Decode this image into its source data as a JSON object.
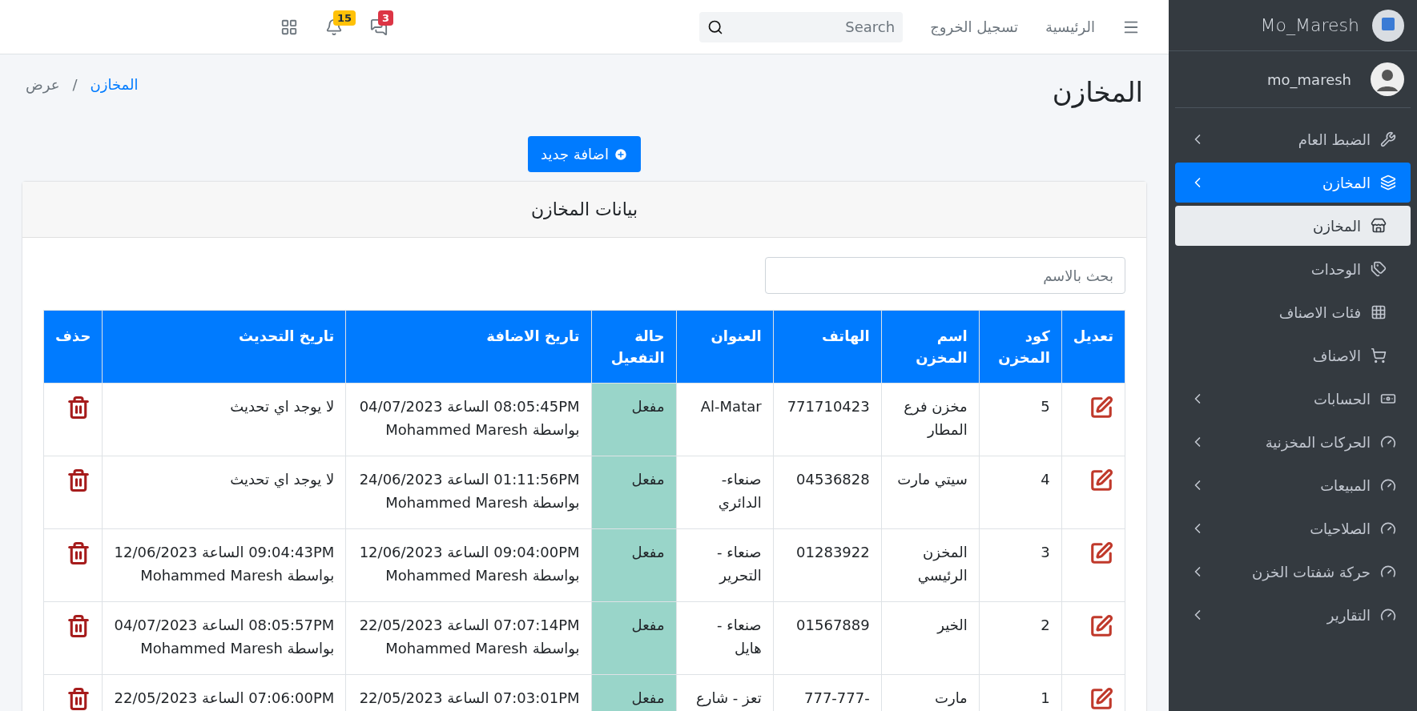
{
  "sidebar": {
    "brand": "Mo_Maresh",
    "user": "mo_maresh",
    "items": [
      {
        "label": "الضبط العام",
        "selected": false,
        "expanded": false,
        "has_arrow": true
      },
      {
        "label": "المخازن",
        "selected": true,
        "expanded": true,
        "has_arrow": true,
        "children": [
          {
            "label": "المخازن",
            "selected": true
          },
          {
            "label": "الوحدات",
            "selected": false
          },
          {
            "label": "فئات الاصناف",
            "selected": false
          },
          {
            "label": "الاصناف",
            "selected": false
          }
        ]
      },
      {
        "label": "الحسابات",
        "selected": false,
        "expanded": false,
        "has_arrow": true
      },
      {
        "label": "الحركات المخزنية",
        "selected": false,
        "expanded": false,
        "has_arrow": true
      },
      {
        "label": "المبيعات",
        "selected": false,
        "expanded": false,
        "has_arrow": true
      },
      {
        "label": "الصلاحيات",
        "selected": false,
        "expanded": false,
        "has_arrow": true
      },
      {
        "label": "حركة شفتات الخزن",
        "selected": false,
        "expanded": false,
        "has_arrow": true
      },
      {
        "label": "التقارير",
        "selected": false,
        "expanded": false,
        "has_arrow": true
      }
    ]
  },
  "topbar": {
    "links": [
      "الرئيسية",
      "تسجيل الخروج"
    ],
    "search": {
      "placeholder": "Search"
    },
    "badges": [
      {
        "count": "3",
        "color": "#dc3545"
      },
      {
        "count": "15",
        "color": "#ffc107"
      }
    ]
  },
  "page": {
    "title": "المخازن",
    "breadcrumb": [
      {
        "label": "المخازن",
        "link": true
      },
      {
        "label": "عرض",
        "link": false
      }
    ],
    "breadcrumb_separator": "/",
    "add_button": "اضافة جديد"
  },
  "card": {
    "title": "بيانات المخازن",
    "search": {
      "placeholder": "بحث بالاسم"
    },
    "columns": [
      "تعديل",
      "كود المخزن",
      "اسم المخزن",
      "الهاتف",
      "العنوان",
      "حالة التفعيل",
      "تاريخ الاضافة",
      "تاريخ التحديث",
      "حذف"
    ],
    "rows": [
      {
        "code": "5",
        "name": "مخزن فرع المطار",
        "phone": "771710423",
        "address": "Al-Matar",
        "status": "مفعل",
        "active": true,
        "added": [
          "08:05:45PM الساعة 04/07/2023",
          "بواسطة Mohammed Maresh"
        ],
        "updated": [
          "لا يوجد اي تحديث"
        ]
      },
      {
        "code": "4",
        "name": "سيتي مارت",
        "phone": "04536828",
        "address": "صنعاء- الدائري",
        "status": "مفعل",
        "active": true,
        "added": [
          "01:11:56PM الساعة 24/06/2023",
          "بواسطة Mohammed Maresh"
        ],
        "updated": [
          "لا يوجد اي تحديث"
        ]
      },
      {
        "code": "3",
        "name": "المخزن الرئيسي",
        "phone": "01283922",
        "address": "صنعاء - التحرير",
        "status": "مفعل",
        "active": true,
        "added": [
          "09:04:00PM الساعة 12/06/2023",
          "بواسطة Mohammed Maresh"
        ],
        "updated": [
          "09:04:43PM الساعة 12/06/2023",
          "بواسطة Mohammed Maresh"
        ]
      },
      {
        "code": "2",
        "name": "الخير",
        "phone": "01567889",
        "address": "صنعاء - هايل",
        "status": "مفعل",
        "active": true,
        "added": [
          "07:07:14PM الساعة 22/05/2023",
          "بواسطة Mohammed Maresh"
        ],
        "updated": [
          "08:05:57PM الساعة 04/07/2023",
          "بواسطة Mohammed Maresh"
        ]
      },
      {
        "code": "1",
        "name": "مارت",
        "phone": "-777-777",
        "address": "تعز - شارع",
        "status": "مفعل",
        "active": true,
        "added": [
          "07:03:01PM الساعة 22/05/2023"
        ],
        "updated": [
          "07:06:00PM الساعة 22/05/2023"
        ]
      }
    ]
  }
}
